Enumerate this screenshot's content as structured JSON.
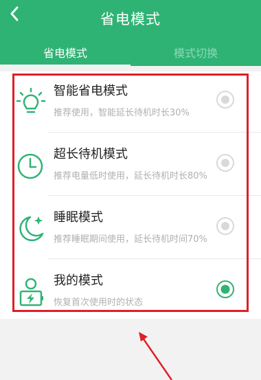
{
  "header": {
    "title": "省电模式",
    "back_icon": "back-chevron-icon"
  },
  "tabs": [
    {
      "label": "省电模式",
      "active": true
    },
    {
      "label": "模式切换",
      "active": false
    }
  ],
  "modes": [
    {
      "name": "智能省电模式",
      "desc": "推荐使用，智能延长待机时长30%",
      "icon": "bulb-icon",
      "selected": false
    },
    {
      "name": "超长待机模式",
      "desc": "推荐电量低时使用，延长待机时长80%",
      "icon": "clock-icon",
      "selected": false
    },
    {
      "name": "睡眠模式",
      "desc": "推荐睡眠期间使用，延长待机时间70%",
      "icon": "moon-icon",
      "selected": false
    },
    {
      "name": "我的模式",
      "desc": "恢复首次使用时的状态",
      "icon": "user-battery-icon",
      "selected": true
    }
  ],
  "colors": {
    "brand": "#2fb375",
    "annotation": "#e01e26",
    "radio_off": "#d9d9d9"
  }
}
